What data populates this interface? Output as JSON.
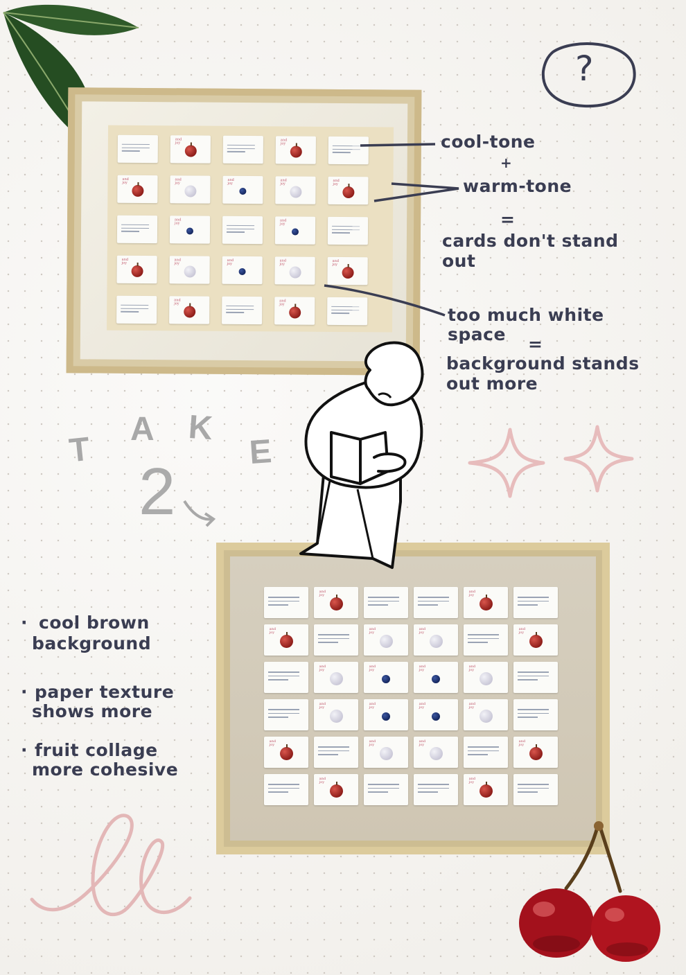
{
  "question_mark": "?",
  "annotations": {
    "cool_tone": "cool-tone",
    "plus": "+",
    "warm_tone": "warm-tone",
    "equals1": "=",
    "cards_dont": "cards don't stand",
    "out": "out",
    "too_much": "too much white",
    "space": "space",
    "equals2": "=",
    "background_stands": "background stands",
    "out_more": "out more"
  },
  "take": {
    "t": "T",
    "a": "A",
    "k": "K",
    "e": "E",
    "two": "2"
  },
  "bullets": {
    "b1_line1": "cool brown",
    "b1_line2": "background",
    "b2_line1": "paper texture",
    "b2_line2": "shows more",
    "b3_line1": "fruit collage",
    "b3_line2": "more cohesive"
  },
  "card_tag": "and\njoy",
  "colors": {
    "ink": "#3a3d52",
    "pink": "#e7bcbc",
    "gray_take": "#a8a8a8",
    "frame_gold": "#d8c89e",
    "mat_top": "#efeadb",
    "mat_bottom": "#d8d0bf"
  },
  "grids": {
    "top": [
      [
        "text",
        "red",
        "text",
        "red",
        "text"
      ],
      [
        "red",
        "pale",
        "blue",
        "pale",
        "red"
      ],
      [
        "text",
        "blue",
        "text",
        "blue",
        "text"
      ],
      [
        "red",
        "pale",
        "blue",
        "pale",
        "red"
      ],
      [
        "text",
        "red",
        "text",
        "red",
        "text"
      ]
    ],
    "bottom": [
      [
        "text",
        "red",
        "text",
        "text",
        "red",
        "text"
      ],
      [
        "red",
        "text",
        "pale",
        "pale",
        "text",
        "red"
      ],
      [
        "text",
        "pale",
        "blue",
        "blue",
        "pale",
        "text"
      ],
      [
        "text",
        "pale",
        "blue",
        "blue",
        "pale",
        "text"
      ],
      [
        "red",
        "text",
        "pale",
        "pale",
        "text",
        "red"
      ],
      [
        "text",
        "red",
        "text",
        "text",
        "red",
        "text"
      ]
    ]
  },
  "icons": [
    "leaf-icon",
    "question-circle-icon",
    "sparkle-icon",
    "cherries-icon",
    "person-reading-icon",
    "squiggle-icon",
    "curved-arrow-icon"
  ]
}
